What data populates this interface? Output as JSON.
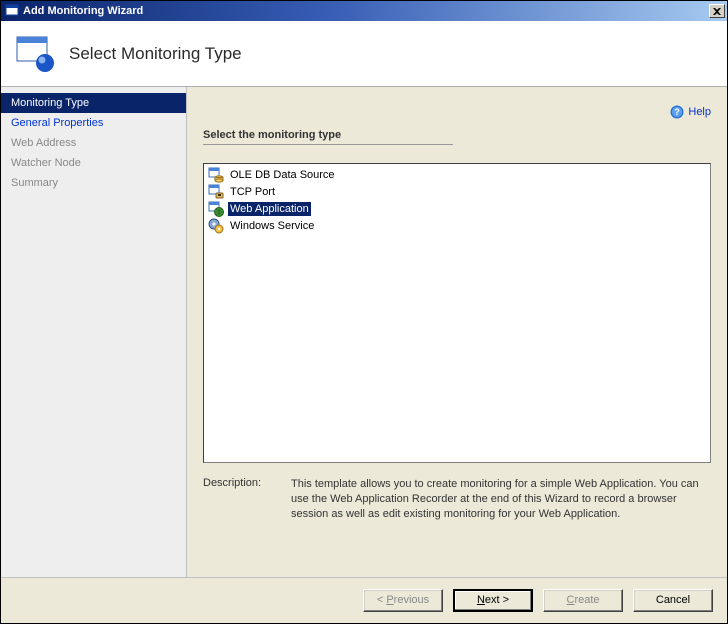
{
  "window": {
    "title": "Add Monitoring Wizard",
    "close_glyph": "✕"
  },
  "header": {
    "title": "Select Monitoring Type"
  },
  "sidebar": {
    "items": [
      {
        "label": "Monitoring Type",
        "state": "active"
      },
      {
        "label": "General Properties",
        "state": "enabled"
      },
      {
        "label": "Web Address",
        "state": "disabled"
      },
      {
        "label": "Watcher Node",
        "state": "disabled"
      },
      {
        "label": "Summary",
        "state": "disabled"
      }
    ]
  },
  "content": {
    "help_label": "Help",
    "heading": "Select the monitoring type",
    "list": [
      {
        "label": "OLE DB Data Source",
        "icon": "db",
        "selected": false
      },
      {
        "label": "TCP Port",
        "icon": "tcp",
        "selected": false
      },
      {
        "label": "Web Application",
        "icon": "web",
        "selected": true
      },
      {
        "label": "Windows Service",
        "icon": "svc",
        "selected": false
      }
    ],
    "description_label": "Description:",
    "description_text": "This template allows you to create monitoring for a simple Web Application. You can use the Web Application Recorder at the end of this Wizard to record a browser session as well as edit existing monitoring for your Web Application."
  },
  "footer": {
    "previous": "< Previous",
    "next": "Next >",
    "create": "Create",
    "cancel": "Cancel"
  }
}
